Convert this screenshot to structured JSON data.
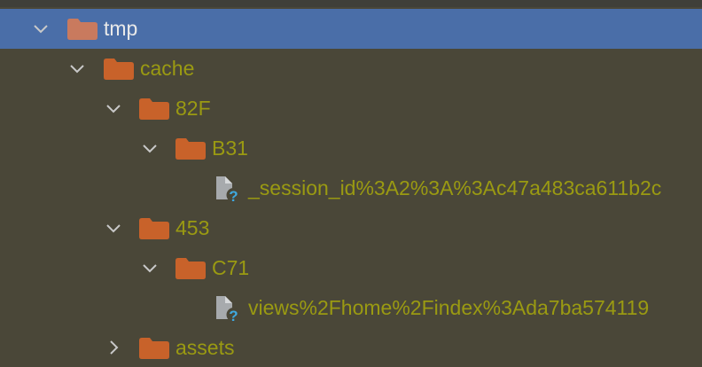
{
  "colors": {
    "background": "#4a4738",
    "selection": "#4a6ea8",
    "folder": "#c8622a",
    "folder_selected": "#c97a5e",
    "text": "#9a9a12",
    "text_selected": "#e9e9e9",
    "chevron": "#c9c9c9",
    "file_icon": "#a7aaad",
    "unknown_badge": "#3fa9e0"
  },
  "tree": {
    "rows": [
      {
        "label": "tmp",
        "type": "folder",
        "expanded": true,
        "selected": true,
        "icon": "folder-icon"
      },
      {
        "label": "cache",
        "type": "folder",
        "expanded": true,
        "selected": false,
        "icon": "folder-icon"
      },
      {
        "label": "82F",
        "type": "folder",
        "expanded": true,
        "selected": false,
        "icon": "folder-icon"
      },
      {
        "label": "B31",
        "type": "folder",
        "expanded": true,
        "selected": false,
        "icon": "folder-icon"
      },
      {
        "label": "_session_id%3A2%3A%3Ac47a483ca611b2c",
        "type": "file",
        "selected": false,
        "icon": "unknown-file-icon"
      },
      {
        "label": "453",
        "type": "folder",
        "expanded": true,
        "selected": false,
        "icon": "folder-icon"
      },
      {
        "label": "C71",
        "type": "folder",
        "expanded": true,
        "selected": false,
        "icon": "folder-icon"
      },
      {
        "label": "views%2Fhome%2Findex%3Ada7ba574119",
        "type": "file",
        "selected": false,
        "icon": "unknown-file-icon"
      },
      {
        "label": "assets",
        "type": "folder",
        "expanded": false,
        "selected": false,
        "icon": "folder-icon"
      }
    ]
  }
}
